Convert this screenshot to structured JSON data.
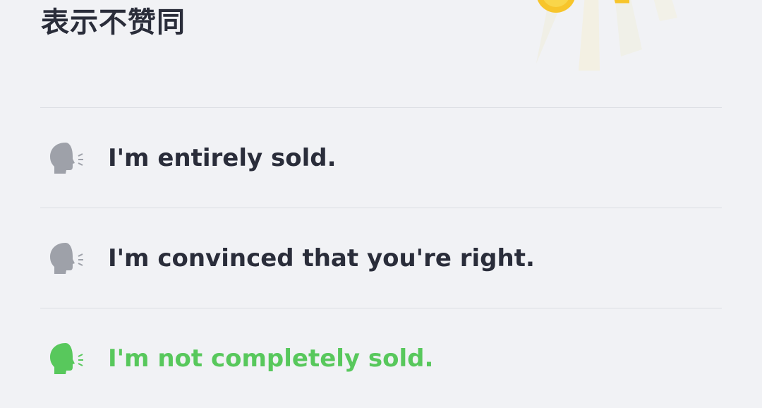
{
  "header": {
    "title": "表示不赞同"
  },
  "phrases": [
    {
      "text": "I'm entirely sold.",
      "icon": "speaking-head-icon",
      "selected": false
    },
    {
      "text": "I'm convinced that you're right.",
      "icon": "speaking-head-icon",
      "selected": false
    },
    {
      "text": "I'm not completely sold.",
      "icon": "speaking-head-icon",
      "selected": true
    }
  ],
  "colors": {
    "background": "#f1f2f5",
    "text": "#2a2d3a",
    "icon_inactive": "#9ea1a9",
    "accent": "#58c85c",
    "reward_yellow": "#f7c52b"
  }
}
